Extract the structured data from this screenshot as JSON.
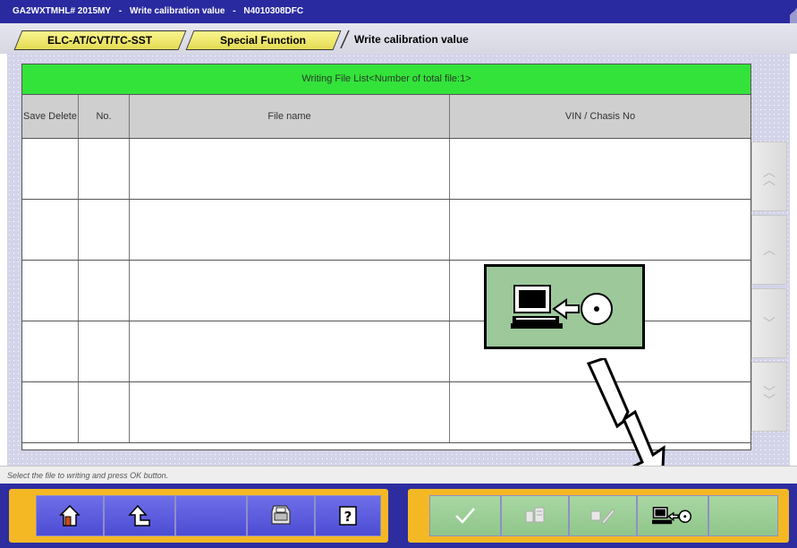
{
  "window": {
    "title_parts": [
      "GA2WXTMHL# 2015MY",
      "-",
      "Write calibration value",
      "-",
      "N4010308DFC"
    ]
  },
  "breadcrumb": {
    "items": [
      "ELC-AT/CVT/TC-SST",
      "Special Function"
    ],
    "current": "Write calibration value"
  },
  "table": {
    "header": "Writing File List<Number of total file:1>",
    "columns": {
      "save_delete": "Save Delete",
      "number": "No.",
      "file_name": "File name",
      "vin": "VIN / Chasis No"
    },
    "row_count": 5
  },
  "scrollbar": {
    "icons": [
      "double-chevron-up-icon",
      "chevron-up-icon",
      "chevron-down-icon",
      "double-chevron-down-icon"
    ]
  },
  "callout": {
    "icon": "write-to-disc-icon"
  },
  "status": {
    "message": "Select the file to writing and press OK button."
  },
  "toolbar": {
    "left_buttons": [
      "home-icon",
      "back-icon",
      "blank",
      "printer-icon",
      "help-icon"
    ],
    "right_buttons": [
      "ok-check-icon",
      "ecu-file-icon",
      "edit-icon",
      "write-to-disc-icon",
      "blank"
    ]
  },
  "colors": {
    "title_bar": "#2a2aa0",
    "table_header": "#33e33a",
    "panel_bg": "#d3d3e9",
    "toolbar_bg": "#2d2da0",
    "toolbar_frame": "#f4b824",
    "callout_bg": "#9cc89a"
  }
}
